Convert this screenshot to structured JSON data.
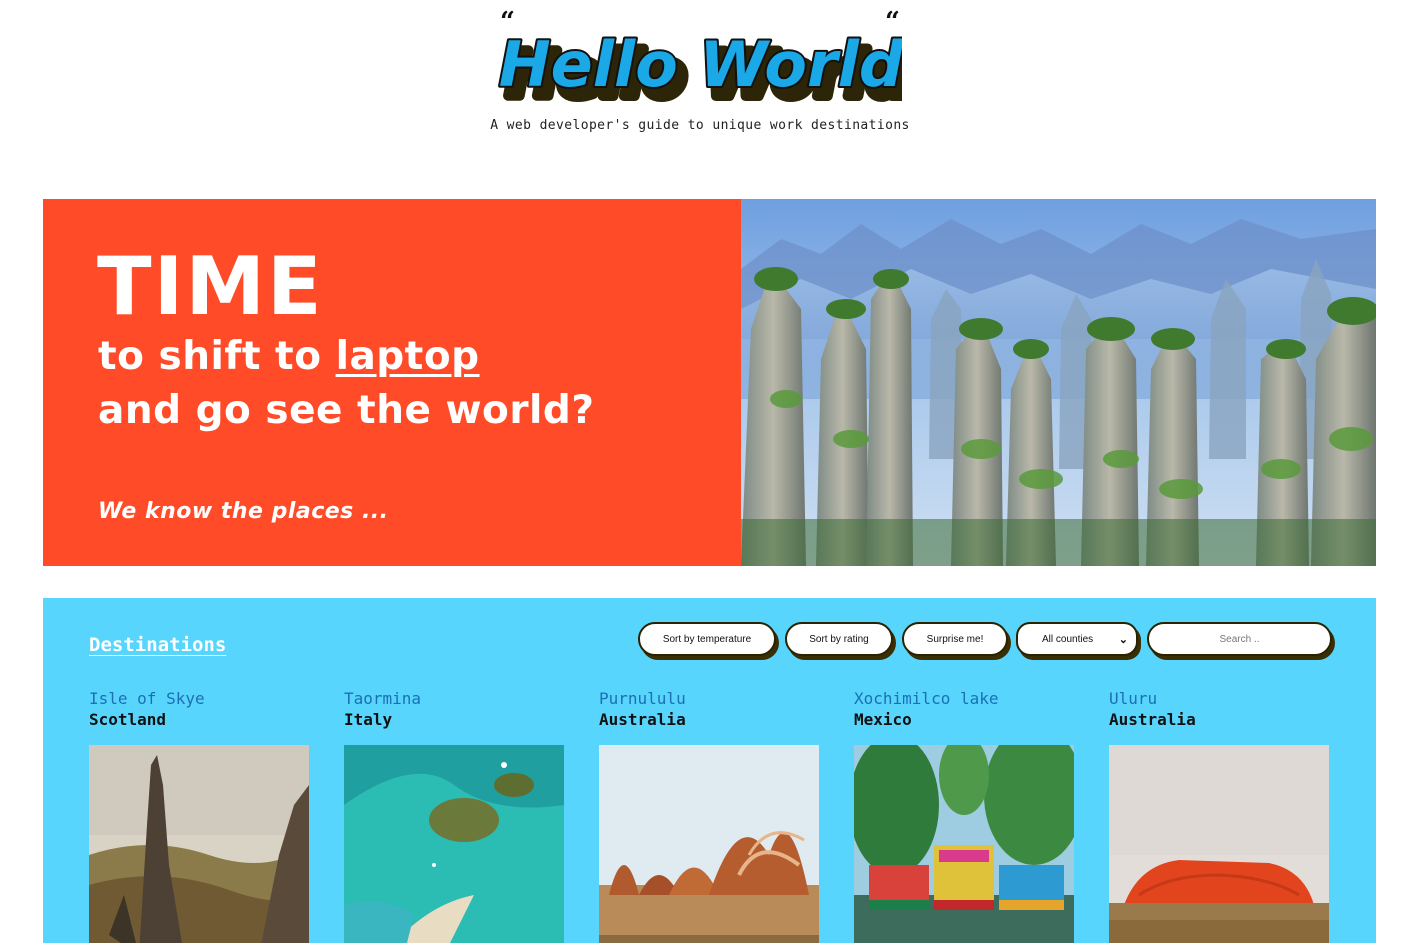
{
  "header": {
    "logo_text": "Hello World",
    "logo_colors": {
      "fill": "#1aa8e6",
      "shadow": "#2c2508",
      "outline": "#111111"
    },
    "tagline": "A web developer's guide to unique work destinations"
  },
  "hero": {
    "title": "TIME",
    "line1_prefix": "to shift to",
    "line1_link": "laptop",
    "line2": "and go see the world?",
    "subtitle": "We know the places ...",
    "background_color": "#ff4b27"
  },
  "destinations": {
    "title": "Destinations",
    "panel_color": "#57d5fd",
    "controls": {
      "sort_temperature": "Sort by temperature",
      "sort_rating": "Sort by rating",
      "surprise": "Surprise me!",
      "country_select": "All counties",
      "search_placeholder": "Search .."
    },
    "items": [
      {
        "city": "Isle of Skye",
        "country": "Scotland"
      },
      {
        "city": "Taormina",
        "country": "Italy"
      },
      {
        "city": "Purnululu",
        "country": "Australia"
      },
      {
        "city": "Xochimilco lake",
        "country": "Mexico"
      },
      {
        "city": "Uluru",
        "country": "Australia"
      }
    ]
  }
}
